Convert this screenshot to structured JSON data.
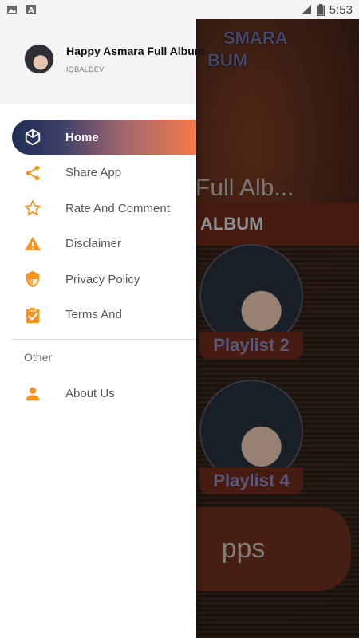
{
  "status_bar": {
    "time": "5:53",
    "icons": [
      "image-icon",
      "a-notification-icon",
      "signal-icon",
      "battery-icon"
    ]
  },
  "background": {
    "banner_text_line1": "SMARA",
    "banner_text_line2": "BUM",
    "marquee": "a Full Alb...",
    "album_bar": "ALBUM",
    "playlist_2": "Playlist 2",
    "playlist_4": "Playlist 4",
    "pill_text": "pps"
  },
  "drawer": {
    "header": {
      "title": "Happy Asmara Full Album",
      "subtitle": "IQBALDEV"
    },
    "items": [
      {
        "label": "Home",
        "icon": "cube-icon"
      },
      {
        "label": "Share App",
        "icon": "share-icon"
      },
      {
        "label": "Rate And Comment",
        "icon": "star-icon"
      },
      {
        "label": "Disclaimer",
        "icon": "warning-icon"
      },
      {
        "label": "Privacy Policy",
        "icon": "shield-icon"
      },
      {
        "label": "Terms And",
        "icon": "clipboard-check-icon"
      }
    ],
    "section_other": "Other",
    "other_items": [
      {
        "label": "About Us",
        "icon": "person-icon"
      }
    ]
  },
  "colors": {
    "accent": "#f7931e",
    "active_start": "#1f2e55",
    "active_end": "#f47b4a"
  }
}
